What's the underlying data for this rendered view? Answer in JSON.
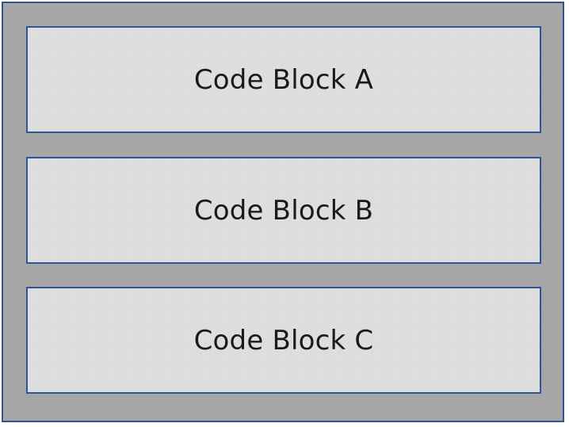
{
  "diagram": {
    "blocks": [
      {
        "label": "Code Block A"
      },
      {
        "label": "Code Block B"
      },
      {
        "label": "Code Block C"
      }
    ],
    "colors": {
      "frame_fill": "#a6a6a6",
      "block_fill": "#dedede",
      "border": "#2f5597",
      "text": "#1a1a1a"
    }
  }
}
